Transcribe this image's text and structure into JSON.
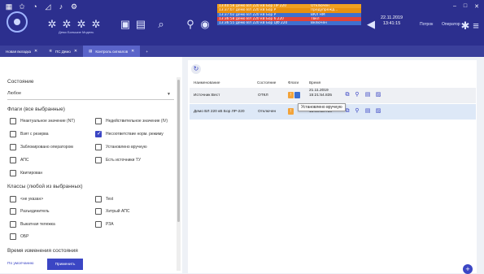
{
  "header": {
    "captions": [
      "Демо Большие Модель"
    ],
    "events": [
      {
        "time": "13:40:58",
        "text": "Демо ВЛ 220 кВ Бор ЛР 220",
        "state": "Отключен",
        "color": "#f0a020"
      },
      {
        "time": "13:37:07",
        "text": "Демо ВЛ 220 кВ Бор Р",
        "state": "Предупрежд...",
        "color": "#f0a020"
      },
      {
        "time": "13:37:02",
        "text": "Демо ВЛ 220 кВ Бор Р",
        "state": "ВКЛ НМ",
        "color": "#3f6fcf"
      },
      {
        "time": "13:36:58",
        "text": "Демо ВЛ 220 кВ Бор 6.220",
        "state": "Твкл",
        "color": "#e0443b"
      },
      {
        "time": "13:36:55",
        "text": "Демо ВЛ 220 кВ Бор ЦФ 220",
        "state": "Включен",
        "color": "#3f6fcf"
      }
    ],
    "date": "22.11.2019",
    "time": "13:41:15",
    "help_label": "Потрок",
    "operator_label": "Оператор"
  },
  "tabs": [
    {
      "label": "Новая вкладка",
      "active": false
    },
    {
      "label": "ПС Демо",
      "active": false
    },
    {
      "label": "Контроль сигналов",
      "active": true
    }
  ],
  "filters": {
    "state_title": "Состояние",
    "state_value": "Любое",
    "flags_title": "Флаги (все выбранные)",
    "flags": [
      {
        "label": "Неактуальное значение (NT)",
        "checked": false
      },
      {
        "label": "Недействительное значение (IV)",
        "checked": false
      },
      {
        "label": "Взят с резерва",
        "checked": false
      },
      {
        "label": "Несоответствие норм. режиму",
        "checked": true
      },
      {
        "label": "Заблокировано оператором",
        "checked": false
      },
      {
        "label": "Установлено вручную",
        "checked": false
      },
      {
        "label": "АПС",
        "checked": false
      },
      {
        "label": "Есть источники ТУ",
        "checked": false
      },
      {
        "label": "Квитирован",
        "checked": false
      }
    ],
    "classes_title": "Классы (любой из выбранных)",
    "classes": [
      {
        "label": "<не указан>",
        "checked": false
      },
      {
        "label": "Test",
        "checked": false
      },
      {
        "label": "Разъединитель",
        "checked": false
      },
      {
        "label": "Хитрый АПС",
        "checked": false
      },
      {
        "label": "Выкатная тележка",
        "checked": false
      },
      {
        "label": "РЗА",
        "checked": false
      },
      {
        "label": "ОБР",
        "checked": false
      }
    ],
    "change_title": "Время изменения состояния",
    "default_button": "По умолчанию",
    "apply_button": "Применить"
  },
  "table": {
    "columns": [
      "Наименование",
      "Состояние",
      "Флаги",
      "Время"
    ],
    "rows": [
      {
        "name": "Источник Вест",
        "state": "ОТКЛ",
        "date": "21.11.2019",
        "time": "15:21:54.835"
      },
      {
        "name": "Демо ВЛ 220 кВ Бор ЛР-220",
        "state": "Отключен",
        "date": "22.11.2019",
        "time": "13:40:58.750"
      }
    ],
    "tooltip": "Установлено вручную"
  },
  "colors": {
    "header": "#2c2f8e",
    "accent": "#3b46c4",
    "flag": "#f2a33a"
  }
}
